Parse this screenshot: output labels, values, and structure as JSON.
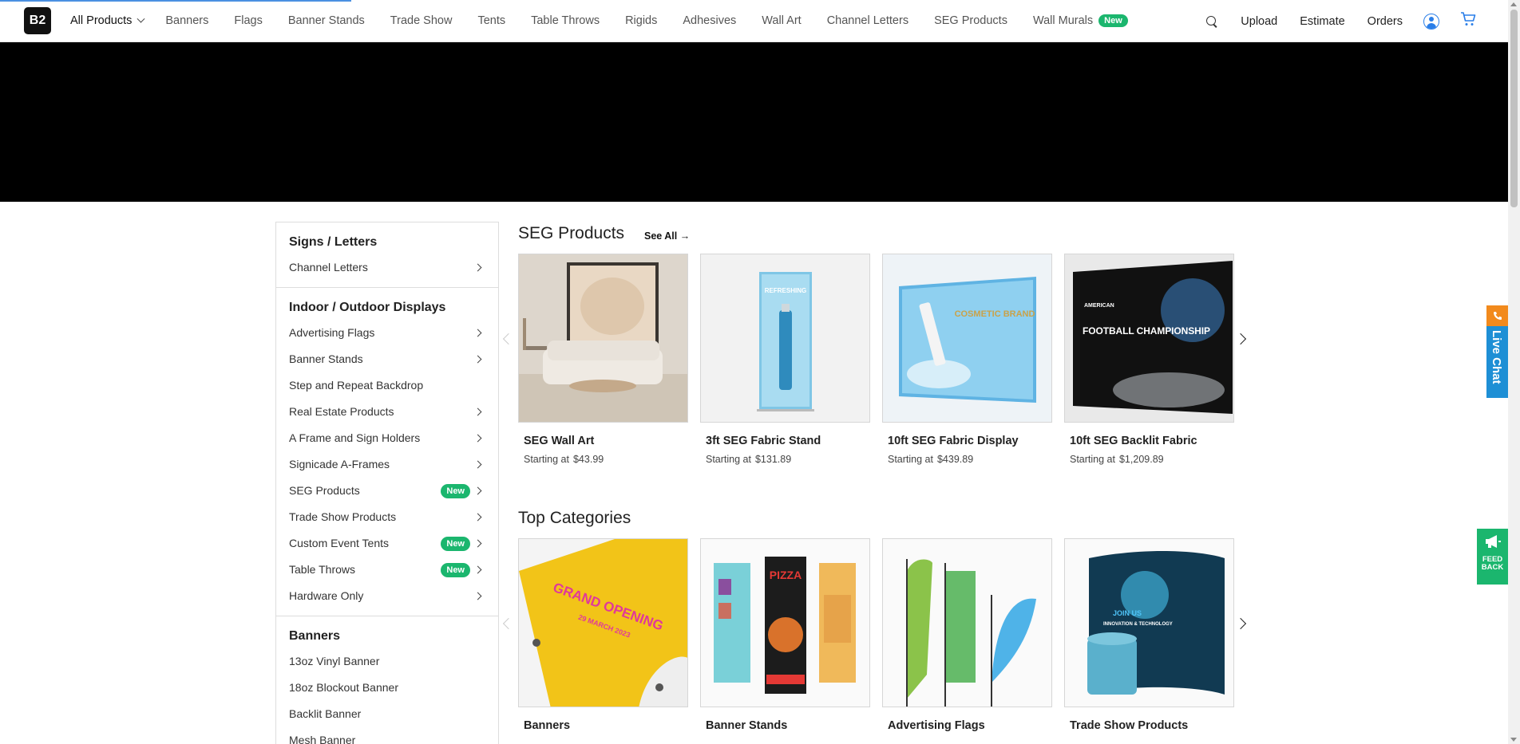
{
  "brand": {
    "logo_text": "B2"
  },
  "nav": {
    "all_products": "All Products",
    "links": [
      "Banners",
      "Flags",
      "Banner Stands",
      "Trade Show",
      "Tents",
      "Table Throws",
      "Rigids",
      "Adhesives",
      "Wall Art",
      "Channel Letters",
      "SEG Products",
      "Wall Murals"
    ],
    "new_badge": "New",
    "right": {
      "upload": "Upload",
      "estimate": "Estimate",
      "orders": "Orders"
    }
  },
  "sidebar": {
    "groups": [
      {
        "heading": "Signs / Letters",
        "items": [
          {
            "label": "Channel Letters",
            "arrow": true,
            "badge": ""
          }
        ]
      },
      {
        "heading": "Indoor / Outdoor Displays",
        "items": [
          {
            "label": "Advertising Flags",
            "arrow": true,
            "badge": ""
          },
          {
            "label": "Banner Stands",
            "arrow": true,
            "badge": ""
          },
          {
            "label": "Step and Repeat Backdrop",
            "arrow": false,
            "badge": ""
          },
          {
            "label": "Real Estate Products",
            "arrow": true,
            "badge": ""
          },
          {
            "label": "A Frame and Sign Holders",
            "arrow": true,
            "badge": ""
          },
          {
            "label": "Signicade A-Frames",
            "arrow": true,
            "badge": ""
          },
          {
            "label": "SEG Products",
            "arrow": true,
            "badge": "New"
          },
          {
            "label": "Trade Show Products",
            "arrow": true,
            "badge": ""
          },
          {
            "label": "Custom Event Tents",
            "arrow": true,
            "badge": "New"
          },
          {
            "label": "Table Throws",
            "arrow": true,
            "badge": "New"
          },
          {
            "label": "Hardware Only",
            "arrow": true,
            "badge": ""
          }
        ]
      },
      {
        "heading": "Banners",
        "items": [
          {
            "label": "13oz Vinyl Banner",
            "arrow": false,
            "badge": ""
          },
          {
            "label": "18oz Blockout Banner",
            "arrow": false,
            "badge": ""
          },
          {
            "label": "Backlit Banner",
            "arrow": false,
            "badge": ""
          },
          {
            "label": "Mesh Banner",
            "arrow": false,
            "badge": ""
          }
        ]
      }
    ]
  },
  "seg_section": {
    "title": "SEG Products",
    "see_all": "See All →",
    "price_prefix": "Starting at",
    "products": [
      {
        "name": "SEG Wall Art",
        "price": "$43.99"
      },
      {
        "name": "3ft SEG Fabric Stand",
        "price": "$131.89",
        "art_text": "REFRESHING"
      },
      {
        "name": "10ft SEG Fabric Display",
        "price": "$439.89",
        "art_text": "COSMETIC BRAND"
      },
      {
        "name": "10ft SEG Backlit Fabric",
        "price": "$1,209.89",
        "art_text": "FOOTBALL CHAMPIONSHIP",
        "art_small": "AMERICAN"
      }
    ]
  },
  "top_categories": {
    "title": "Top Categories",
    "items": [
      {
        "name": "Banners",
        "art_text": "GRAND OPENING",
        "art_date": "29 MARCH 2023"
      },
      {
        "name": "Banner Stands",
        "art_text": "PIZZA"
      },
      {
        "name": "Advertising Flags"
      },
      {
        "name": "Trade Show Products",
        "art_text": "JOIN US",
        "art_sub": "INNOVATION & TECHNOLOGY"
      }
    ]
  },
  "widgets": {
    "live_chat": "Live Chat",
    "feedback": "FEED BACK"
  },
  "colors": {
    "accent_green": "#1bb66e",
    "chat_blue": "#1e8fd5",
    "chat_orange": "#f28a1d",
    "hero": "#000000"
  }
}
